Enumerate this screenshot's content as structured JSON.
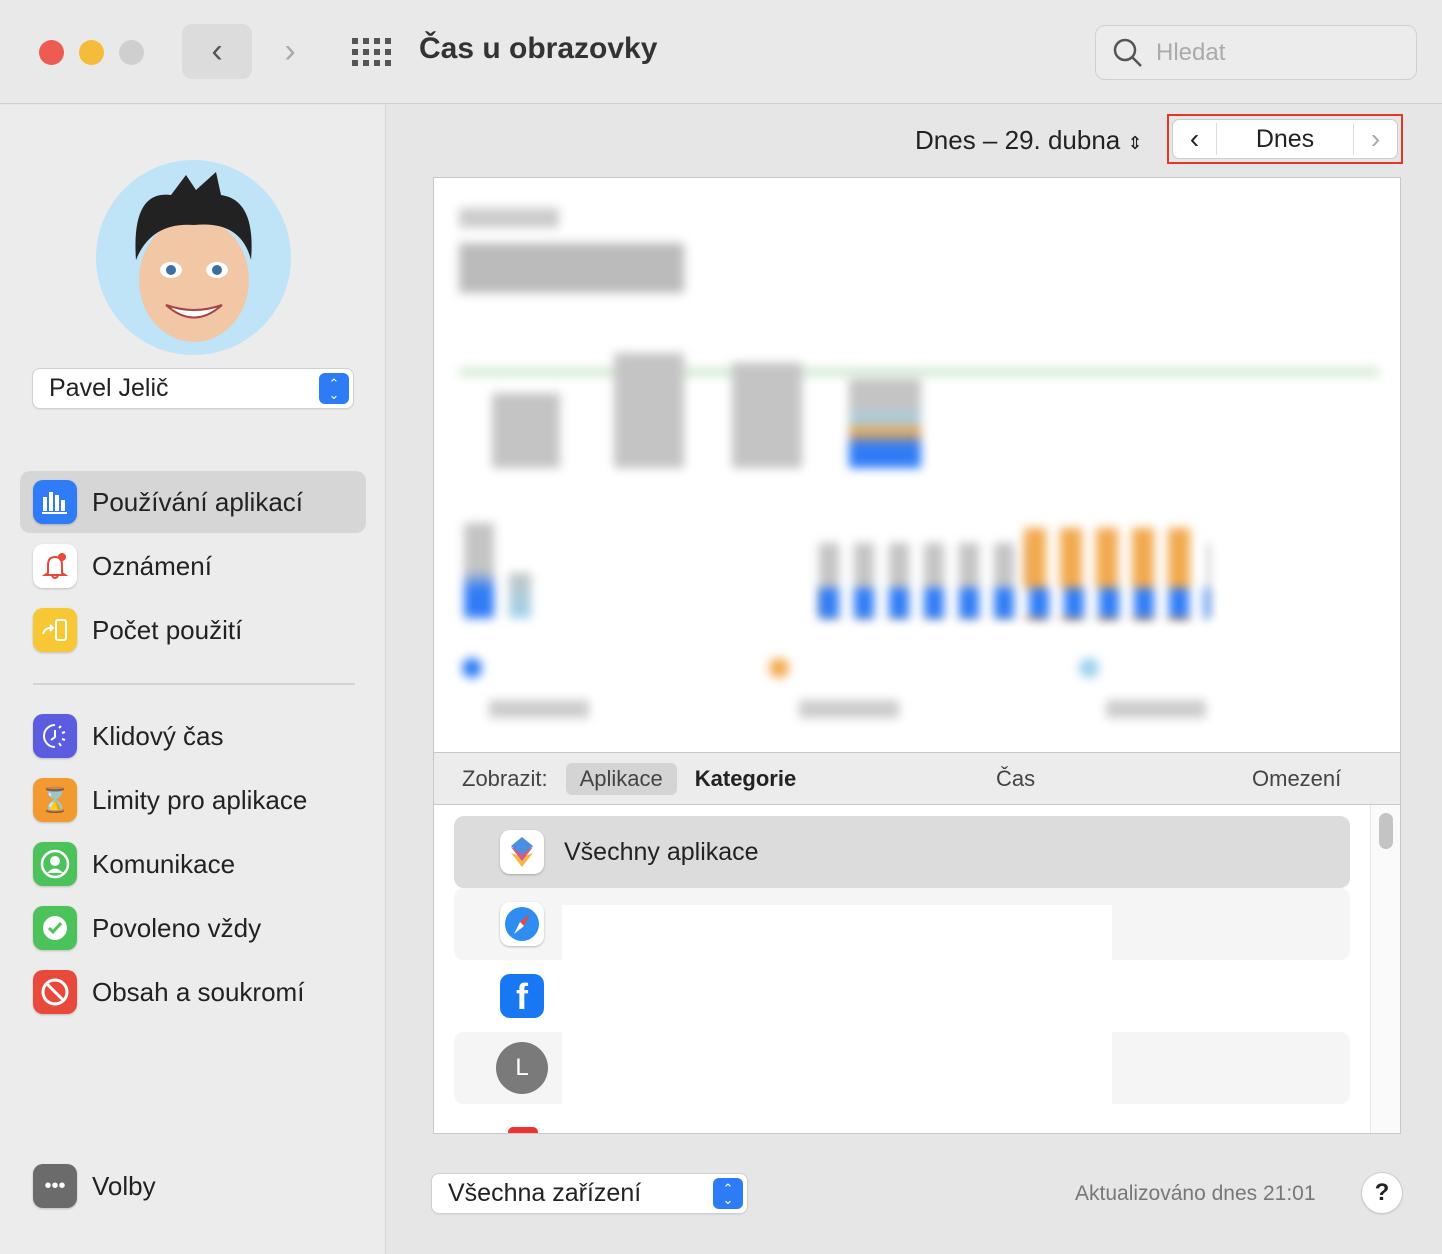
{
  "window": {
    "title": "Čas u obrazovky",
    "search_placeholder": "Hledat"
  },
  "sidebar": {
    "user": "Pavel Jelič",
    "items": [
      {
        "label": "Používání aplikací",
        "icon": "bar-chart-icon",
        "color": "#2f7cf6",
        "selected": true
      },
      {
        "label": "Oznámení",
        "icon": "bell-icon",
        "color": "#ffffff"
      },
      {
        "label": "Počet použití",
        "icon": "pickup-icon",
        "color": "#f7c834"
      },
      {
        "label": "Klidový čas",
        "icon": "downtime-icon",
        "color": "#5b5ce0"
      },
      {
        "label": "Limity pro aplikace",
        "icon": "hourglass-icon",
        "color": "#f29a30"
      },
      {
        "label": "Komunikace",
        "icon": "person-circle-icon",
        "color": "#4cc35a"
      },
      {
        "label": "Povoleno vždy",
        "icon": "checkmark-badge-icon",
        "color": "#4cc35a"
      },
      {
        "label": "Obsah a soukromí",
        "icon": "prohibited-icon",
        "color": "#e8493a"
      }
    ],
    "options": "Volby"
  },
  "main": {
    "date_label": "Dnes – 29. dubna",
    "today_button": "Dnes",
    "toolbar": {
      "show_label": "Zobrazit:",
      "apps": "Aplikace",
      "categories": "Kategorie",
      "time": "Čas",
      "limits": "Omezení"
    },
    "list": [
      {
        "label": "Všechny aplikace"
      },
      {
        "icon": "safari-icon"
      },
      {
        "icon": "facebook-icon"
      },
      {
        "icon": "letter-avatar-icon",
        "letter": "L"
      }
    ],
    "device_select": "Všechna zařízení",
    "updated": "Aktualizováno dnes 21:01",
    "help": "?"
  }
}
